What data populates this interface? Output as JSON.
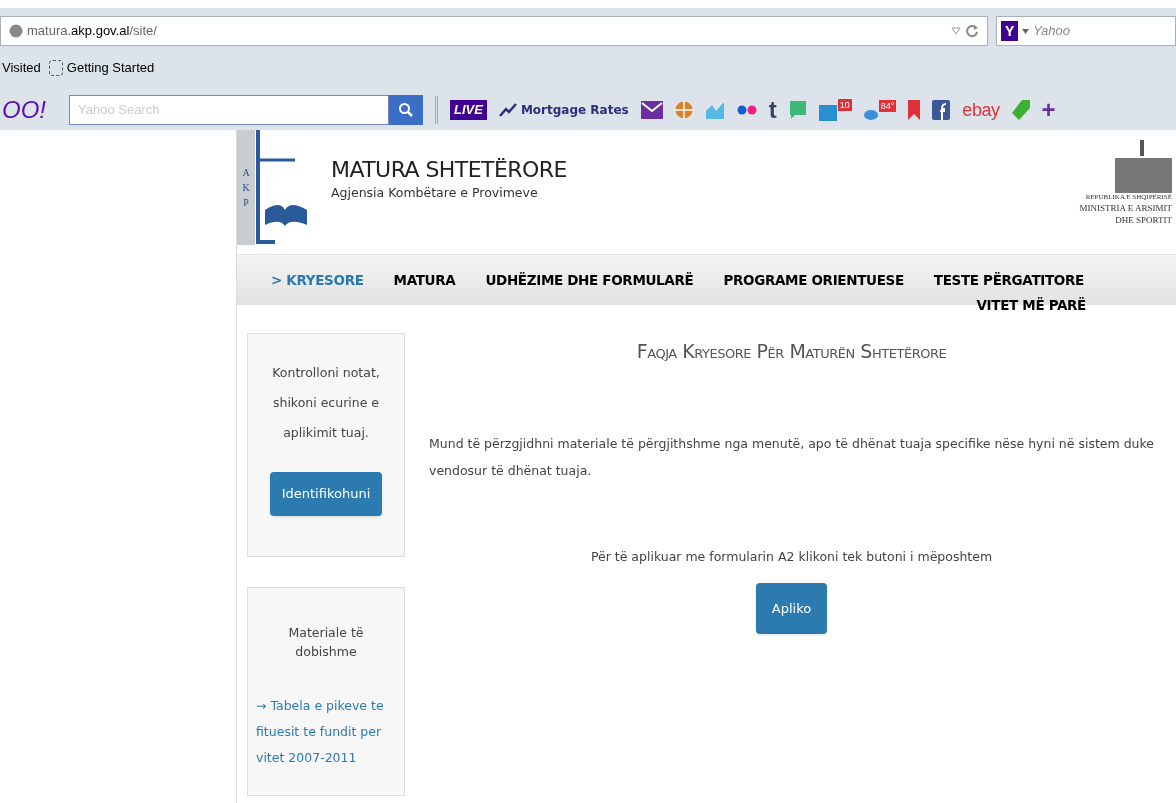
{
  "browser": {
    "url": {
      "host_pre": "matura.",
      "host": "akp.gov.al",
      "path": "/site/"
    },
    "search_engine": "Yahoo",
    "search_engine_letter": "Y",
    "bookmarks": [
      "Visited",
      "Getting Started"
    ],
    "toolbar": {
      "logo": "OO!",
      "search_placeholder": "Yahoo Search",
      "live": "LIVE",
      "mortgage": "Mortgage Rates",
      "news_badge": "10",
      "weather_badge": "84°",
      "tumblr": "t",
      "ebay": "ebay",
      "plus": "+"
    }
  },
  "header": {
    "logo_letters": [
      "A",
      "K",
      "P"
    ],
    "title": "MATURA SHTETËRORE",
    "subtitle": "Agjensia Kombëtare e Provimeve",
    "ministry": [
      "REPUBLIKA E SHQIPËRISË",
      "MINISTRIA E ARSIMIT",
      "DHE SPORTIT"
    ]
  },
  "nav": {
    "items": [
      {
        "label": "> KRYESORE",
        "selected": true
      },
      {
        "label": "MATURA",
        "selected": false
      },
      {
        "label": "UDHËZIME DHE FORMULARË",
        "selected": false
      },
      {
        "label": "PROGRAME ORIENTUESE",
        "selected": false
      },
      {
        "label": "TESTE PËRGATITORE",
        "selected": false
      }
    ],
    "wrapped_item": {
      "label": "VITET MË PARË",
      "selected": false
    }
  },
  "sidebar": [
    {
      "kind": "login",
      "text": "Kontrolloni notat, shikoni ecurine e aplikimit tuaj.",
      "button": "Identifikohuni"
    },
    {
      "kind": "links",
      "text": "Materiale të dobishme",
      "link": "→ Tabela e pikeve te fituesit te fundit per vitet 2007-2011"
    }
  ],
  "main": {
    "title": "Faqja Kryesore Për Maturën Shtetërore",
    "intro": "Mund të përzgjidhni materiale të përgjithshme nga menutë, apo të dhënat tuaja specifike nëse hyni në sistem duke vendosur të dhënat tuaja.",
    "apply_text": "Për të aplikuar me formularin A2 klikoni tek butoni i mëposhtem",
    "apply_button": "Apliko"
  }
}
